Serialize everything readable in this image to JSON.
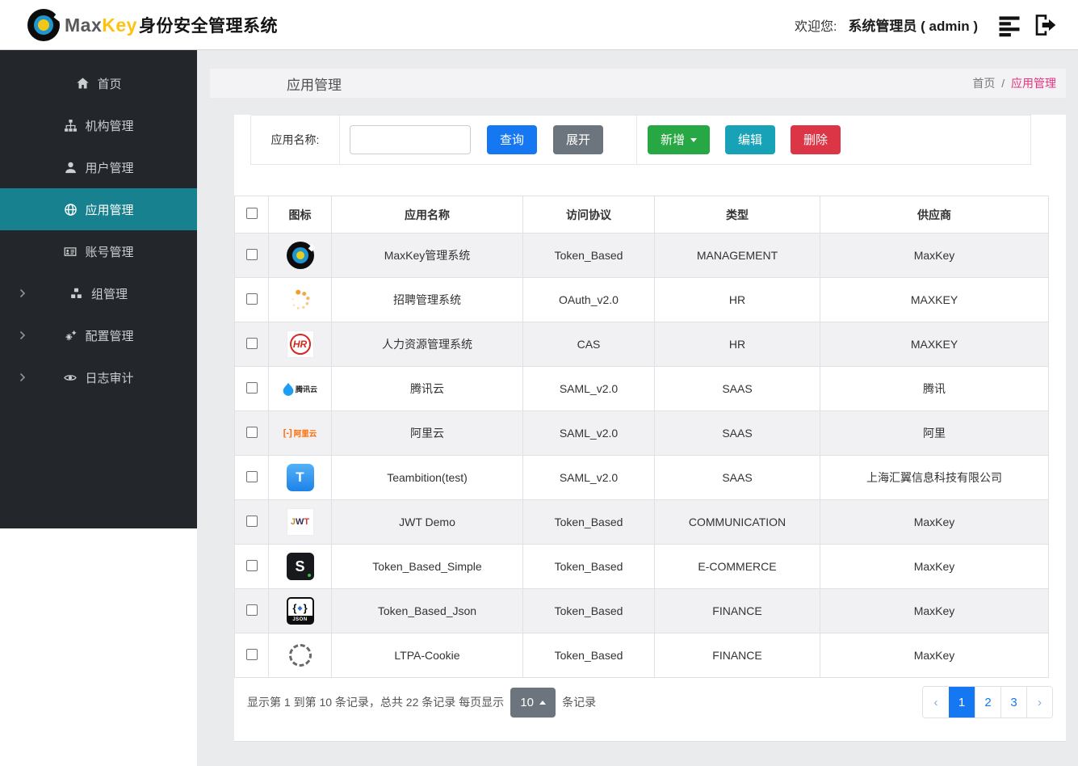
{
  "colors": {
    "primary_blue": "#1677f2",
    "success_green": "#28a745",
    "info_teal": "#17a2b8",
    "danger_red": "#dc3545",
    "secondary_gray": "#6c757d",
    "sidebar_bg": "#23262b",
    "sidebar_active_teal": "#17818f",
    "breadcrumb_pink": "#e6327e",
    "brand_yellow": "#ffc20e"
  },
  "header": {
    "brand_max": "Max",
    "brand_key": "Key",
    "brand_suffix": "身份安全管理系统",
    "welcome_label": "欢迎您:",
    "user_label": "系统管理员 ( admin )"
  },
  "sidebar": {
    "items": [
      {
        "key": "home",
        "label": "首页",
        "icon": "home-icon",
        "active": false,
        "expandable": false
      },
      {
        "key": "org",
        "label": "机构管理",
        "icon": "sitemap-icon",
        "active": false,
        "expandable": false
      },
      {
        "key": "user",
        "label": "用户管理",
        "icon": "user-icon",
        "active": false,
        "expandable": false
      },
      {
        "key": "app",
        "label": "应用管理",
        "icon": "globe-icon",
        "active": true,
        "expandable": false
      },
      {
        "key": "account",
        "label": "账号管理",
        "icon": "id-card-icon",
        "active": false,
        "expandable": false
      },
      {
        "key": "group",
        "label": "组管理",
        "icon": "cubes-icon",
        "active": false,
        "expandable": true
      },
      {
        "key": "config",
        "label": "配置管理",
        "icon": "gears-icon",
        "active": false,
        "expandable": true
      },
      {
        "key": "audit",
        "label": "日志审计",
        "icon": "eye-icon",
        "active": false,
        "expandable": true
      }
    ]
  },
  "page": {
    "title": "应用管理",
    "breadcrumb_home": "首页",
    "breadcrumb_separator": "/",
    "breadcrumb_current": "应用管理"
  },
  "search": {
    "name_label": "应用名称:",
    "input_value": "",
    "query_button": "查询",
    "expand_button": "展开",
    "add_button": "新增",
    "edit_button": "编辑",
    "delete_button": "删除"
  },
  "table": {
    "columns": [
      "图标",
      "应用名称",
      "访问协议",
      "类型",
      "供应商"
    ],
    "rows": [
      {
        "icon": "maxkey",
        "name": "MaxKey管理系统",
        "protocol": "Token_Based",
        "type": "MANAGEMENT",
        "vendor": "MaxKey"
      },
      {
        "icon": "spinner",
        "name": "招聘管理系统",
        "protocol": "OAuth_v2.0",
        "type": "HR",
        "vendor": "MAXKEY"
      },
      {
        "icon": "hr",
        "name": "人力资源管理系统",
        "protocol": "CAS",
        "type": "HR",
        "vendor": "MAXKEY"
      },
      {
        "icon": "tencent",
        "name": "腾讯云",
        "protocol": "SAML_v2.0",
        "type": "SAAS",
        "vendor": "腾讯"
      },
      {
        "icon": "aliyun",
        "name": "阿里云",
        "protocol": "SAML_v2.0",
        "type": "SAAS",
        "vendor": "阿里"
      },
      {
        "icon": "teambition",
        "name": "Teambition(test)",
        "protocol": "SAML_v2.0",
        "type": "SAAS",
        "vendor": "上海汇翼信息科技有限公司"
      },
      {
        "icon": "jwt",
        "name": "JWT Demo",
        "protocol": "Token_Based",
        "type": "COMMUNICATION",
        "vendor": "MaxKey"
      },
      {
        "icon": "s-black",
        "name": "Token_Based_Simple",
        "protocol": "Token_Based",
        "type": "E-COMMERCE",
        "vendor": "MaxKey"
      },
      {
        "icon": "json",
        "name": "Token_Based_Json",
        "protocol": "Token_Based",
        "type": "FINANCE",
        "vendor": "MaxKey"
      },
      {
        "icon": "ltpa",
        "name": "LTPA-Cookie",
        "protocol": "Token_Based",
        "type": "FINANCE",
        "vendor": "MaxKey"
      }
    ]
  },
  "pagination": {
    "summary_prefix": "显示第 1 到第 10 条记录，总共 22 条记录 每页显示",
    "page_size": "10",
    "summary_suffix": "条记录",
    "prev_label": "‹",
    "next_label": "›",
    "pages": [
      "1",
      "2",
      "3"
    ],
    "active_page": "1"
  }
}
